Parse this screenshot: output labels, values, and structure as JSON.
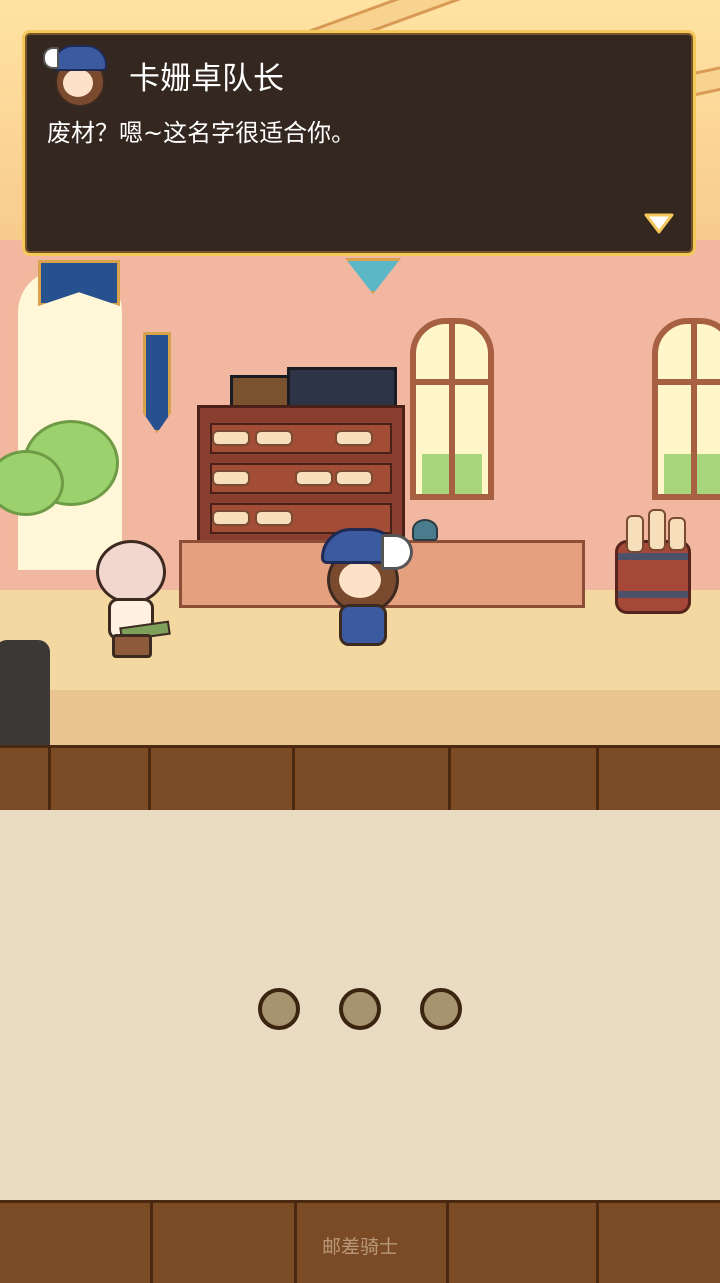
{
  "dialog": {
    "speaker": "卡姗卓队长",
    "line": "废材？嗯~这名字很适合你。",
    "next_icon": "triangle-down-icon",
    "border_color": "#f4c85a",
    "background_color": "#33271f"
  },
  "loading": {
    "dots_count": 3
  },
  "footer": {
    "title": "邮差骑士"
  }
}
